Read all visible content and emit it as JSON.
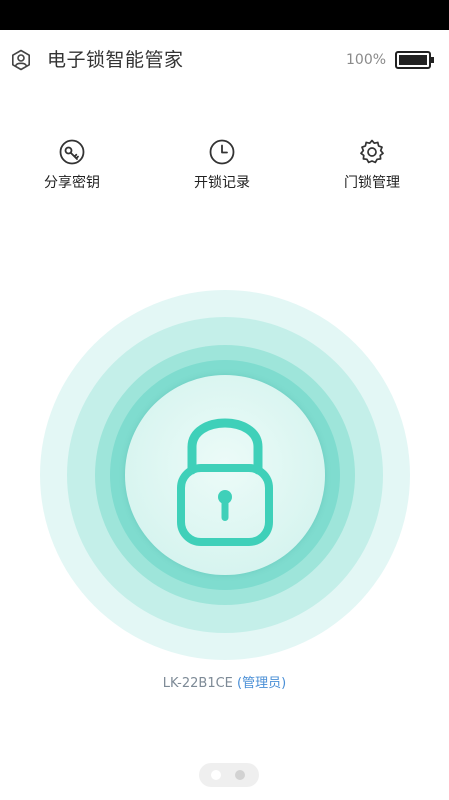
{
  "header": {
    "title": "电子锁智能管家",
    "battery_percent": "100%",
    "user_icon": "user-shield-icon",
    "battery_icon": "battery-full-icon"
  },
  "actions": [
    {
      "label": "分享密钥",
      "icon": "key-icon"
    },
    {
      "label": "开锁记录",
      "icon": "clock-icon"
    },
    {
      "label": "门锁管理",
      "icon": "gear-icon"
    }
  ],
  "lock": {
    "icon": "padlock-icon",
    "state": "locked"
  },
  "device": {
    "id": "LK-22B1CE",
    "role": "(管理员)"
  },
  "pager": {
    "page_count": 2,
    "current_page": 1
  },
  "colors": {
    "accent": "#4fd6c4",
    "ring_outer": "#e3f7f5",
    "ring_2": "#c4efe9",
    "ring_3": "#9ee5da",
    "ring_4": "#7fdccf",
    "lock_core": "#dcf6f2",
    "role_link": "#4a8fd6"
  }
}
